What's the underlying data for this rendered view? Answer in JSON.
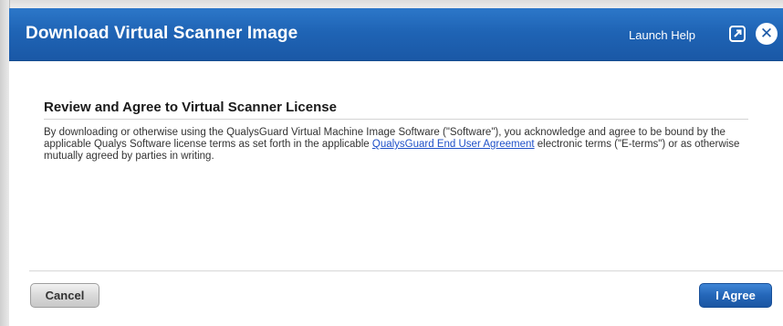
{
  "header": {
    "title": "Download Virtual Scanner Image",
    "help_label": "Launch Help",
    "popout_icon": "popout-icon",
    "close_icon": "close-icon",
    "close_glyph": "✕"
  },
  "section": {
    "title": "Review and Agree to Virtual Scanner License",
    "text_before_link": "By downloading or otherwise using the QualysGuard Virtual Machine Image Software (\"Software\"), you acknowledge and agree to be bound by the applicable Qualys Software license terms as set forth in the applicable ",
    "link_text": "QualysGuard End User Agreement",
    "text_after_link": " electronic terms (\"E-terms\") or as otherwise mutually agreed by parties in writing."
  },
  "footer": {
    "cancel_label": "Cancel",
    "agree_label": "I Agree"
  },
  "colors": {
    "header_blue": "#1f64b5",
    "link_blue": "#1e50c8",
    "agree_button": "#2466b8"
  }
}
